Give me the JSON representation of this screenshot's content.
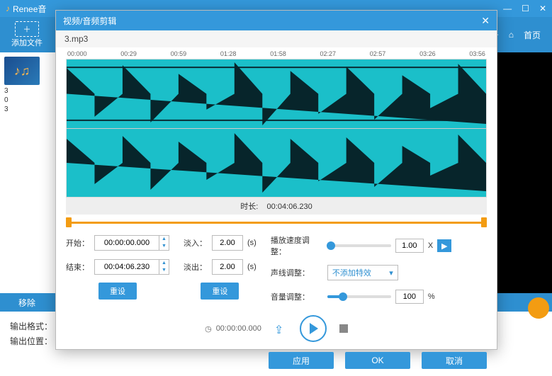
{
  "mainWindow": {
    "title": "Renee音",
    "winMin": "—",
    "winMax": "☐",
    "winClose": "✕",
    "links": {
      "about": "于",
      "home": "首页"
    }
  },
  "toolbar": {
    "addFile": "添加文件"
  },
  "sidebar": {
    "fileName": "3",
    "line2": "0",
    "line3": "3"
  },
  "removeBtn": "移除",
  "footer": {
    "outFormat": "输出格式：",
    "outPath": "输出位置："
  },
  "dialog": {
    "title": "视频/音频剪辑",
    "subtitle": "3.mp3",
    "timeline": [
      "00:000",
      "00:29",
      "00:59",
      "01:28",
      "01:58",
      "02:27",
      "02:57",
      "03:26",
      "03:56"
    ],
    "durationLabel": "时长:",
    "durationValue": "00:04:06.230",
    "start": {
      "label": "开始：",
      "value": "00:00:00.000"
    },
    "end": {
      "label": "结束：",
      "value": "00:04:06.230"
    },
    "fadeIn": {
      "label": "淡入：",
      "value": "2.00",
      "unit": "(s)"
    },
    "fadeOut": {
      "label": "淡出：",
      "value": "2.00",
      "unit": "(s)"
    },
    "reset": "重设",
    "speed": {
      "label": "播放速度调整：",
      "value": "1.00",
      "suffix": "X"
    },
    "voice": {
      "label": "声线调整：",
      "value": "不添加特效"
    },
    "volume": {
      "label": "音量调整：",
      "value": "100",
      "suffix": "%"
    },
    "playbackTime": "00:00:00.000",
    "buttons": {
      "apply": "应用",
      "ok": "OK",
      "cancel": "取消"
    }
  }
}
